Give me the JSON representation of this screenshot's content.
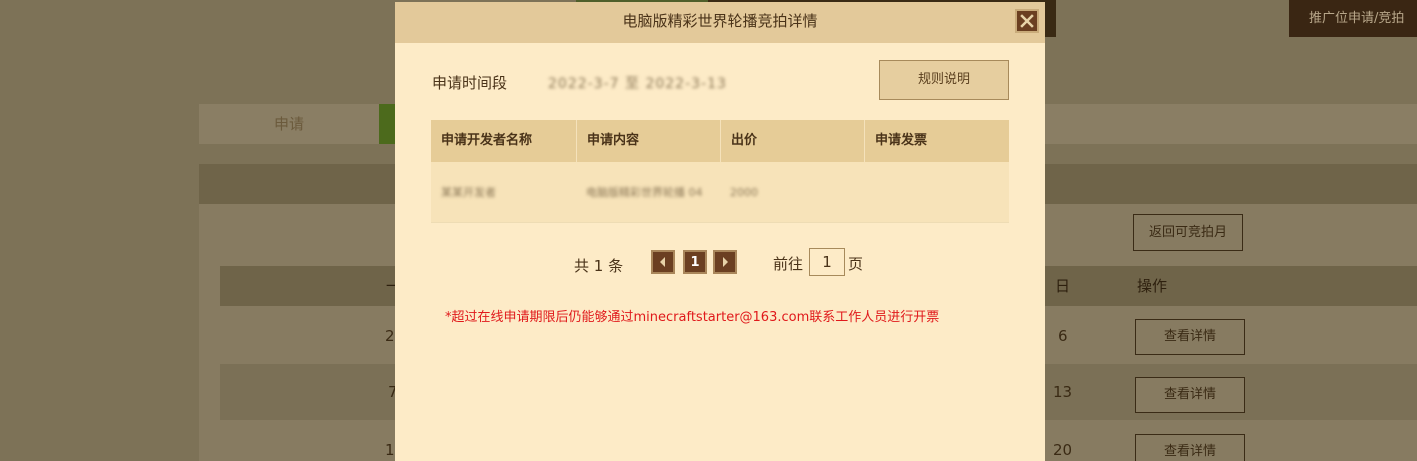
{
  "background": {
    "top_button_right": "推广位申请/竞拍",
    "tab_apply": "申请",
    "return_button": "返回可竞拍月",
    "table_headers": {
      "day": "日",
      "action": "操作"
    },
    "rows": [
      {
        "first_col": "2",
        "day": "6",
        "action": "查看详情"
      },
      {
        "first_col": "7",
        "day": "13",
        "action": "查看详情"
      },
      {
        "first_col": "1",
        "day": "20",
        "action": "查看详情"
      }
    ],
    "first_header": "一"
  },
  "modal": {
    "title": "电脑版精彩世界轮播竞拍详情",
    "period_label": "申请时间段",
    "period_value": "2022-3-7 至 2022-3-13",
    "rules_button": "规则说明",
    "table": {
      "headers": [
        "申请开发者名称",
        "申请内容",
        "出价",
        "申请发票"
      ],
      "rows": [
        {
          "developer": "某某开发者",
          "content": "电脑版精彩世界轮播 04",
          "price": "2000",
          "invoice": ""
        }
      ]
    },
    "pager": {
      "total_text": "共 1 条",
      "current_page": "1",
      "goto_prefix": "前往",
      "goto_value": "1",
      "goto_suffix": "页"
    },
    "notice": "*超过在线申请期限后仍能够通过minecraftstarter@163.com联系工作人员进行开票"
  },
  "colors": {
    "modal_bg": "#fdebc7",
    "header_bg": "#e3c99a",
    "accent_brown": "#6b3f21",
    "notice_red": "#e0191b",
    "overlay_bg": "#7d7257"
  }
}
